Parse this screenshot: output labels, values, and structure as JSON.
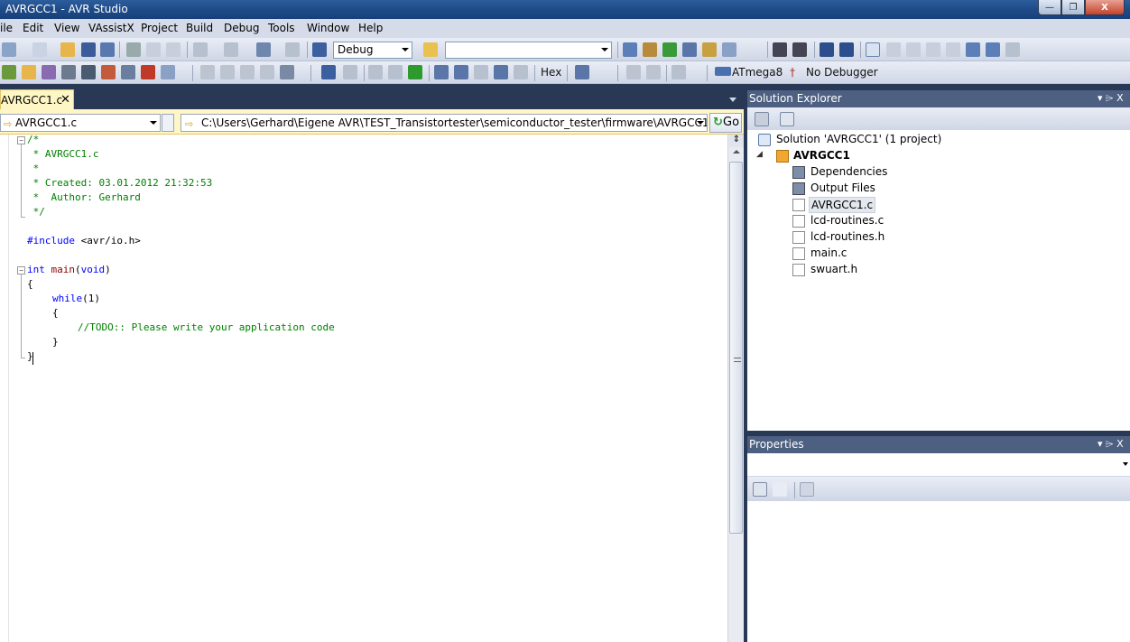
{
  "window": {
    "title": "AVRGCC1 - AVR Studio",
    "minimize": "—",
    "maximize": "❐",
    "close": "X"
  },
  "menu": [
    "ile",
    "Edit",
    "View",
    "VAssistX",
    "Project",
    "Build",
    "Debug",
    "Tools",
    "Window",
    "Help"
  ],
  "toolbar": {
    "config_value": "Debug",
    "platform_value": "",
    "hex_label": "Hex",
    "device_label": "ATmega8",
    "debugger_label": "No Debugger"
  },
  "document_tab": {
    "label": "AVRGCC1.c",
    "close": "✕"
  },
  "navbar": {
    "file_combo": "AVRGCC1.c",
    "path": "C:\\Users\\Gerhard\\Eigene AVR\\TEST_Transistortester\\semiconductor_tester\\firmware\\AVRGCC1\\AVRGC",
    "go_label": "Go"
  },
  "code": {
    "l1": "/*",
    "l2": " * AVRGCC1.c",
    "l3": " *",
    "l4": " * Created: 03.01.2012 21:32:53",
    "l5": " *  Author: Gerhard",
    "l6": " */",
    "l8_kw": "#include",
    "l8_rest": " <avr/io.h>",
    "l10_kw": "int",
    "l10_fn": "main",
    "l10_p1": "(",
    "l10_kw2": "void",
    "l10_p2": ")",
    "l11": "{",
    "l12_kw": "while",
    "l12_rest": "(1)",
    "l13": "{",
    "l14": "//TODO:: Please write your application code",
    "l15": "}",
    "l16": "}"
  },
  "solution_explorer": {
    "title": "Solution Explorer",
    "pin": "▾  ⌲  X",
    "solution": "Solution 'AVRGCC1' (1 project)",
    "project": "AVRGCC1",
    "items": [
      "Dependencies",
      "Output Files",
      "AVRGCC1.c",
      "lcd-routines.c",
      "lcd-routines.h",
      "main.c",
      "swuart.h"
    ]
  },
  "properties": {
    "title": "Properties",
    "pin": "▾  ⌲  X"
  }
}
